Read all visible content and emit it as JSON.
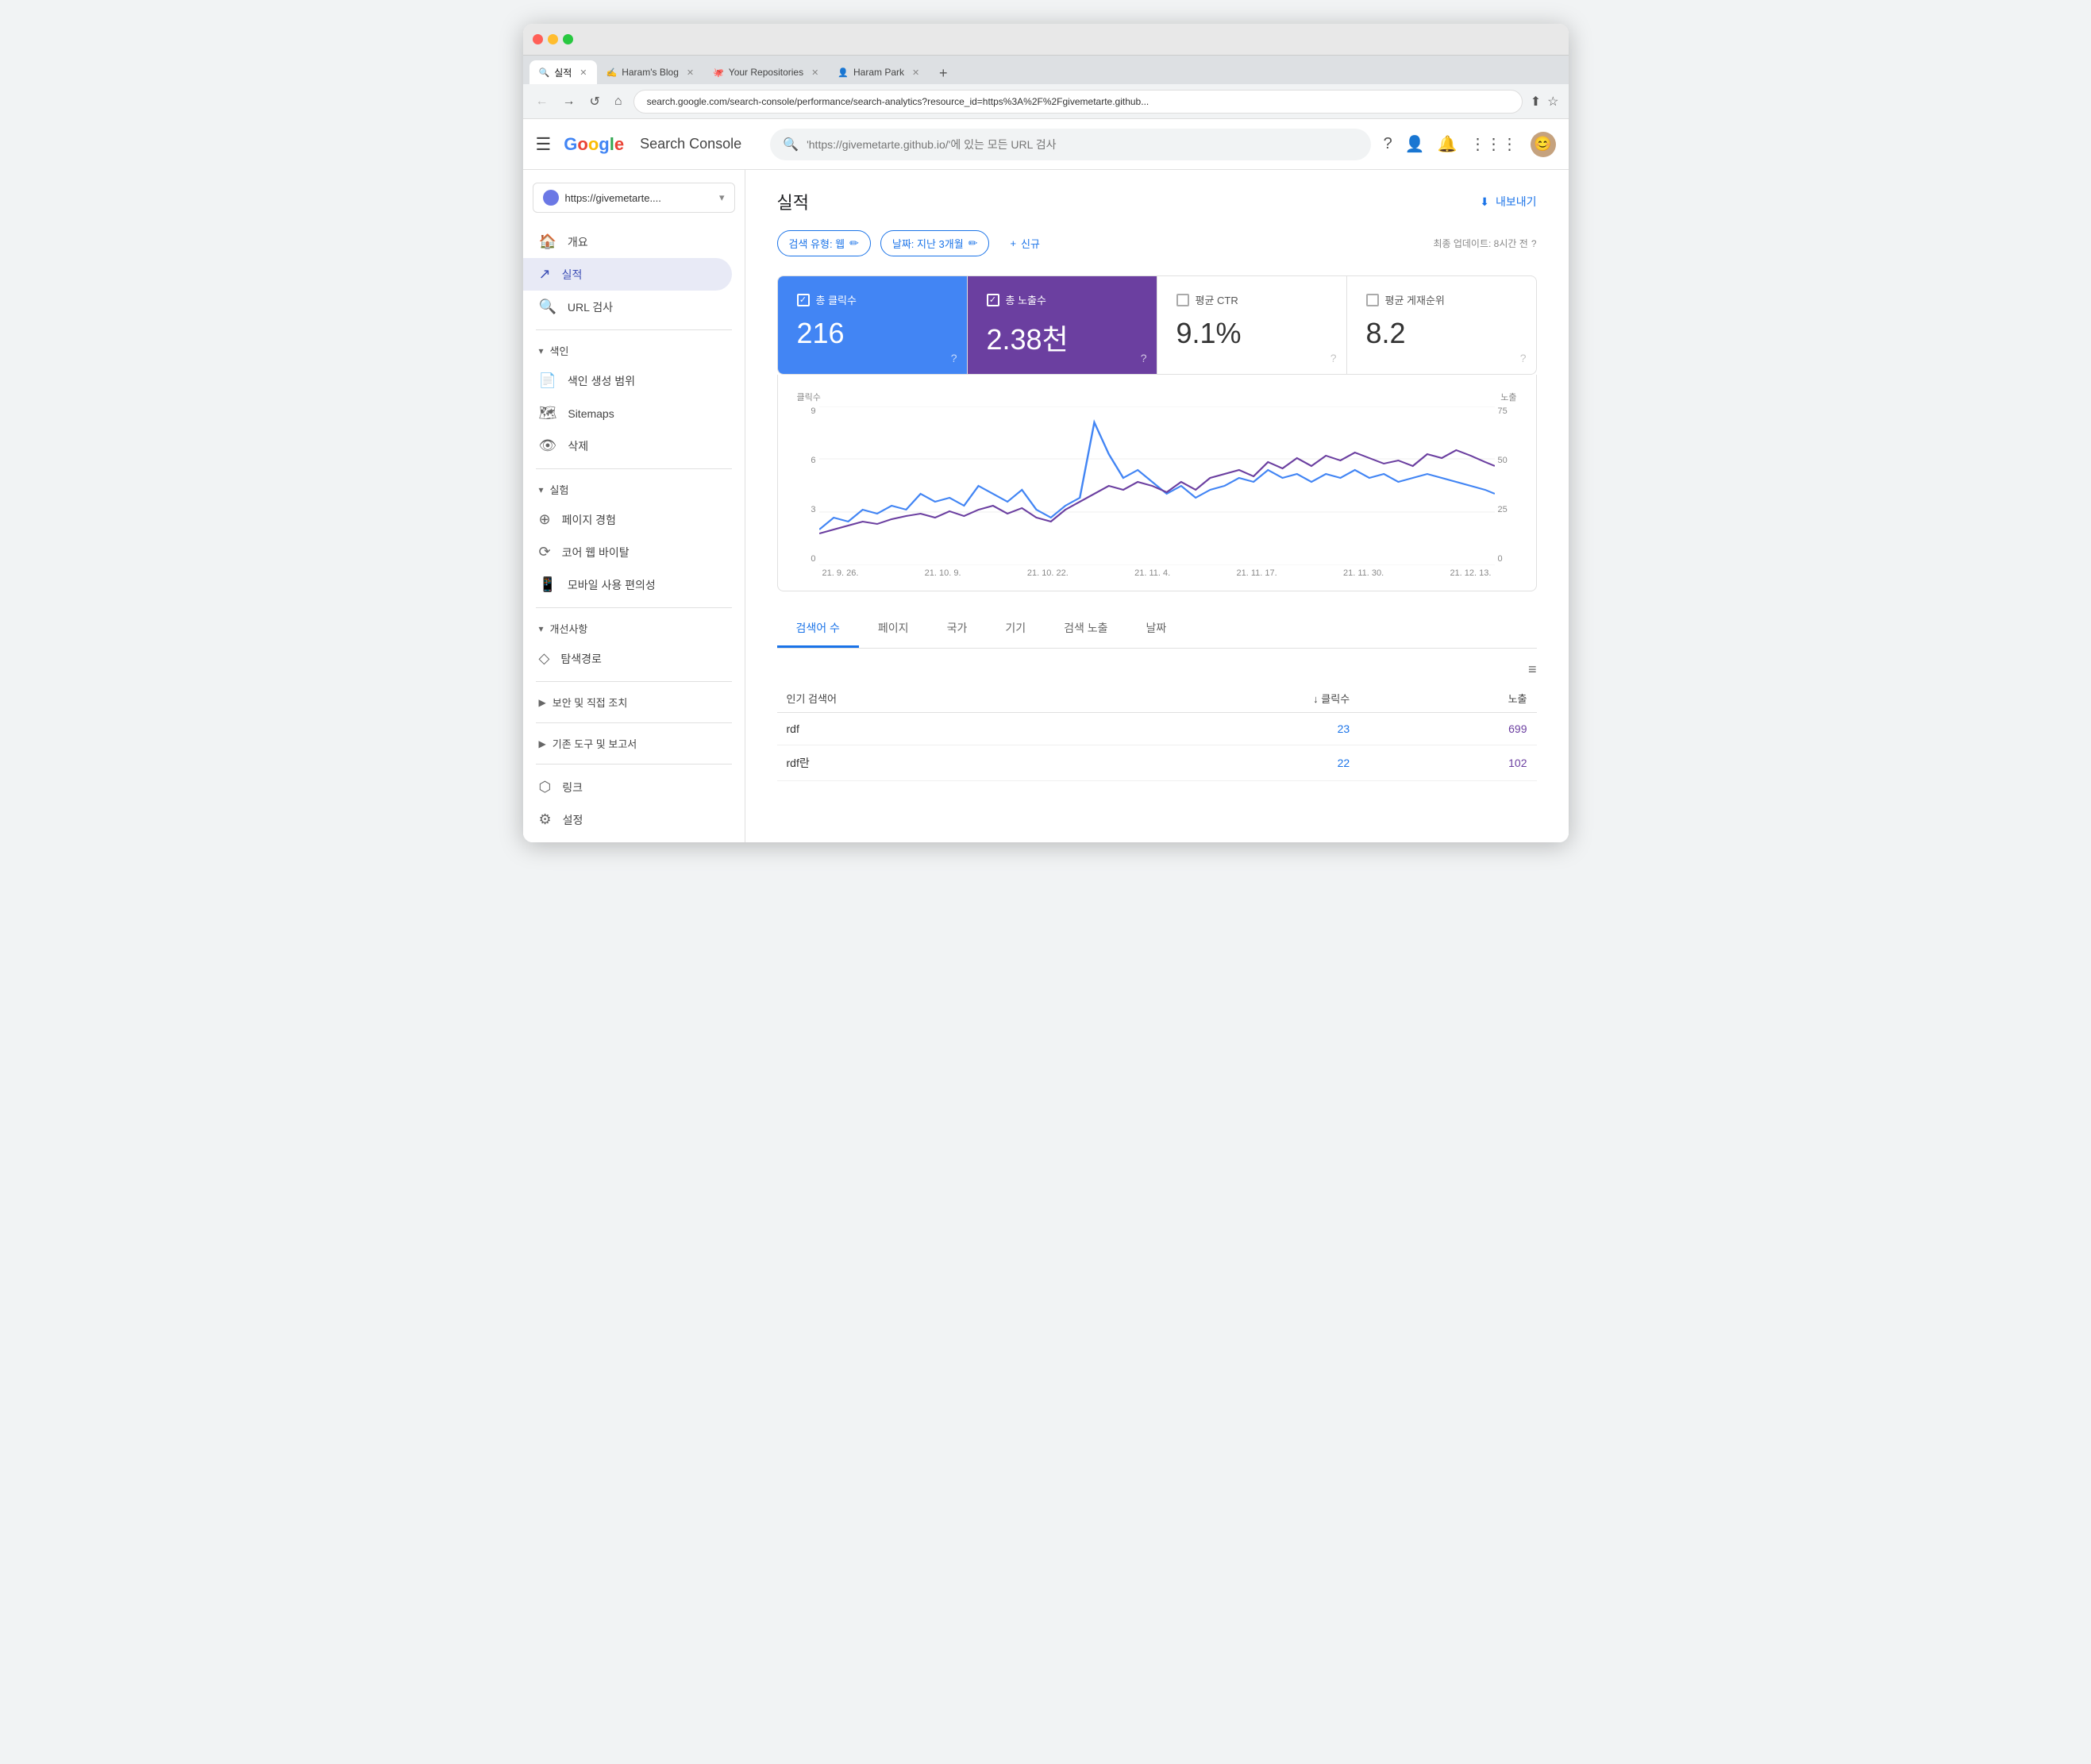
{
  "browser": {
    "tabs": [
      {
        "id": "tab1",
        "label": "실적",
        "icon": "🔍",
        "active": true
      },
      {
        "id": "tab2",
        "label": "Haram's Blog",
        "icon": "✍️",
        "active": false
      },
      {
        "id": "tab3",
        "label": "Your Repositories",
        "icon": "🐙",
        "active": false
      },
      {
        "id": "tab4",
        "label": "Haram Park",
        "icon": "👤",
        "active": false
      }
    ],
    "address": "search.google.com/search-console/performance/search-analytics?resource_id=https%3A%2F%2Fgivemetarte.github...",
    "new_tab_label": "+"
  },
  "header": {
    "menu_label": "☰",
    "logo": "Google",
    "app_name": "Search Console",
    "search_placeholder": "'https://givemetarte.github.io/'에 있는 모든 URL 검사",
    "export_label": "내보내기"
  },
  "sidebar": {
    "property": "https://givemetarte....",
    "nav_items": [
      {
        "id": "overview",
        "label": "개요",
        "icon": "🏠"
      },
      {
        "id": "performance",
        "label": "실적",
        "icon": "↗",
        "active": true
      }
    ],
    "url_inspection": "URL 검사",
    "sections": [
      {
        "label": "색인",
        "items": [
          {
            "id": "coverage",
            "label": "색인 생성 범위",
            "icon": "📄"
          },
          {
            "id": "sitemaps",
            "label": "Sitemaps",
            "icon": "🗺"
          },
          {
            "id": "removals",
            "label": "삭제",
            "icon": "👁"
          }
        ]
      },
      {
        "label": "실험",
        "items": [
          {
            "id": "page-exp",
            "label": "페이지 경험",
            "icon": "⊕"
          },
          {
            "id": "core-web",
            "label": "코어 웹 바이탈",
            "icon": "⟳"
          },
          {
            "id": "mobile",
            "label": "모바일 사용 편의성",
            "icon": "📱"
          }
        ]
      },
      {
        "label": "개선사항",
        "items": [
          {
            "id": "breadcrumbs",
            "label": "탐색경로",
            "icon": "◇"
          }
        ]
      },
      {
        "label": "보안 및 직접 조치",
        "items": []
      },
      {
        "label": "기존 도구 및 보고서",
        "items": []
      }
    ],
    "links_label": "링크",
    "settings_label": "설정"
  },
  "content": {
    "page_title": "실적",
    "export_label": "내보내기",
    "filters": [
      {
        "label": "검색 유형: 웹",
        "editable": true
      },
      {
        "label": "날짜: 지난 3개월",
        "editable": true
      }
    ],
    "add_filter_label": "신규",
    "last_updated": "최종 업데이트: 8시간 전",
    "metrics": [
      {
        "id": "clicks",
        "label": "총 클릭수",
        "value": "216",
        "checked": true,
        "active": true,
        "color": "blue"
      },
      {
        "id": "impressions",
        "label": "총 노출수",
        "value": "2.38천",
        "checked": true,
        "active": true,
        "color": "purple"
      },
      {
        "id": "ctr",
        "label": "평균 CTR",
        "value": "9.1%",
        "checked": false,
        "active": false,
        "color": "none"
      },
      {
        "id": "position",
        "label": "평균 게재순위",
        "value": "8.2",
        "checked": false,
        "active": false,
        "color": "none"
      }
    ],
    "chart": {
      "y_label_left": "클릭수",
      "y_label_right": "노출",
      "y_axis_left": [
        "9",
        "6",
        "3",
        "0"
      ],
      "y_axis_right": [
        "75",
        "50",
        "25",
        "0"
      ],
      "x_labels": [
        "21. 9. 26.",
        "21. 10. 9.",
        "21. 10. 22.",
        "21. 11. 4.",
        "21. 11. 17.",
        "21. 11. 30.",
        "21. 12. 13."
      ]
    },
    "table_tabs": [
      {
        "id": "queries",
        "label": "검색어 수",
        "active": true
      },
      {
        "id": "pages",
        "label": "페이지"
      },
      {
        "id": "countries",
        "label": "국가"
      },
      {
        "id": "devices",
        "label": "기기"
      },
      {
        "id": "search-appearance",
        "label": "검색 노출"
      },
      {
        "id": "dates",
        "label": "날짜"
      }
    ],
    "table": {
      "col_query": "인기 검색어",
      "col_clicks": "클릭수",
      "col_impressions": "노출",
      "rows": [
        {
          "query": "rdf",
          "clicks": 23,
          "impressions": 699
        },
        {
          "query": "rdf란",
          "clicks": 22,
          "impressions": 102
        }
      ]
    }
  }
}
